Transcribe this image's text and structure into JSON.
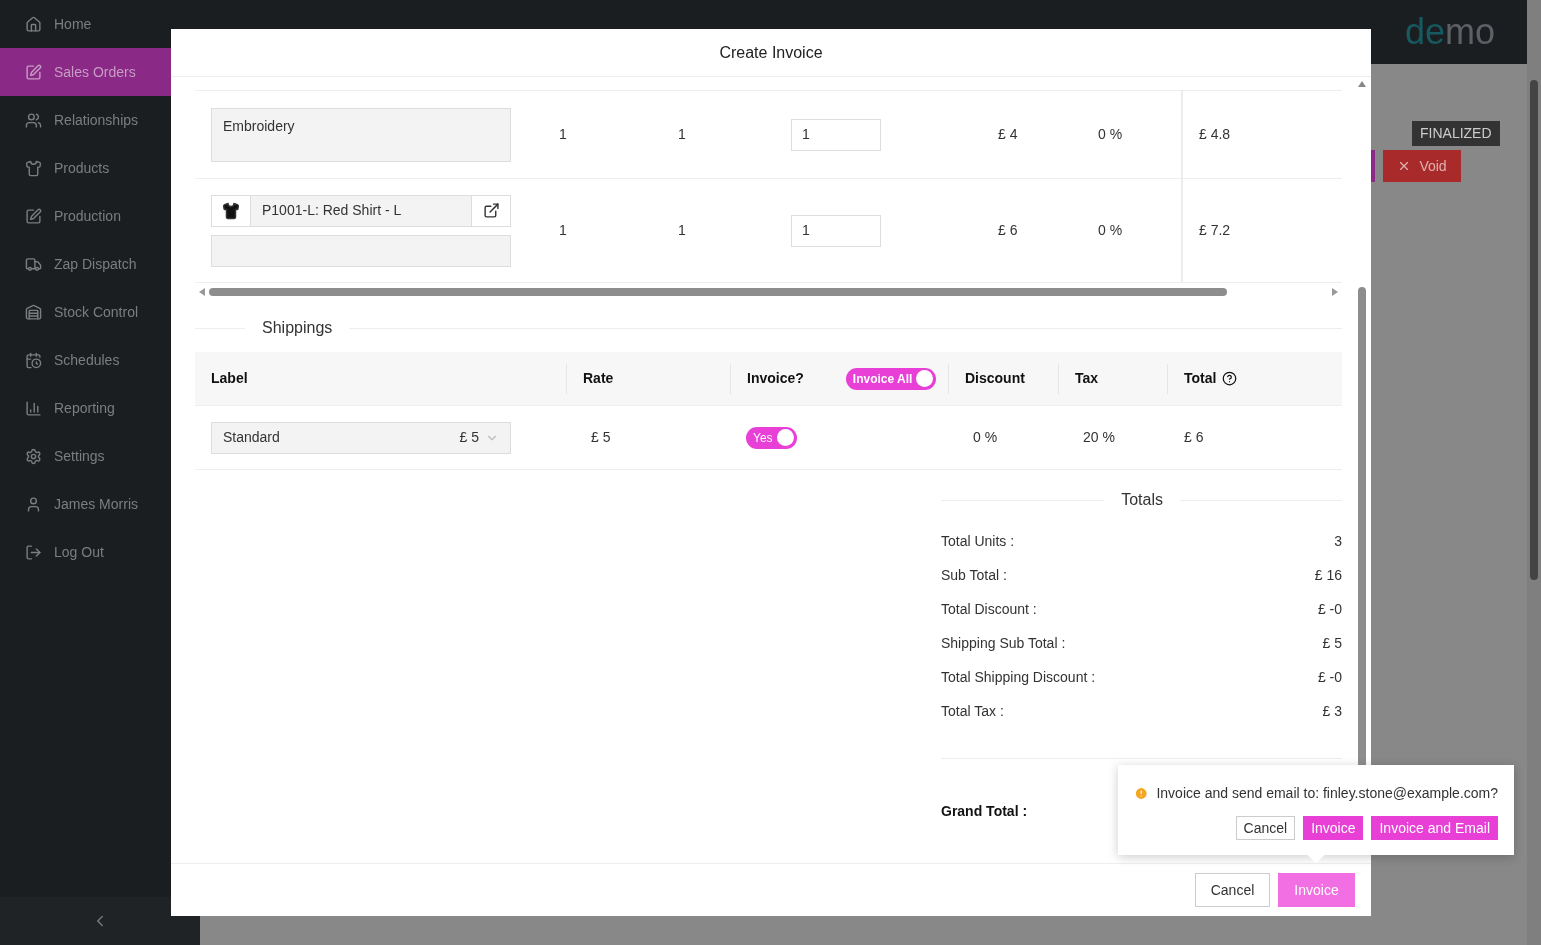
{
  "sidebar": {
    "items": [
      {
        "label": "Home",
        "selected": false
      },
      {
        "label": "Sales Orders",
        "selected": true
      },
      {
        "label": "Relationships",
        "selected": false
      },
      {
        "label": "Products",
        "selected": false
      },
      {
        "label": "Production",
        "selected": false
      },
      {
        "label": "Zap Dispatch",
        "selected": false
      },
      {
        "label": "Stock Control",
        "selected": false
      },
      {
        "label": "Schedules",
        "selected": false
      },
      {
        "label": "Reporting",
        "selected": false
      },
      {
        "label": "Settings",
        "selected": false
      },
      {
        "label": "James Morris",
        "selected": false
      },
      {
        "label": "Log Out",
        "selected": false
      }
    ]
  },
  "header": {
    "brand": [
      "de",
      "mo"
    ]
  },
  "background": {
    "status_badge": "FINALIZED",
    "void_button": "Void"
  },
  "dialog": {
    "title": "Create Invoice",
    "line_items": [
      {
        "kind": "service",
        "description": "Embroidery",
        "col_2": "1",
        "col_3": "1",
        "quantity": "1",
        "price": "£ 4",
        "discount": "0 %",
        "total": "£ 4.8"
      },
      {
        "kind": "product",
        "product": "P1001-L: Red Shirt - L",
        "col_2": "1",
        "col_3": "1",
        "quantity": "1",
        "price": "£ 6",
        "discount": "0 %",
        "total": "£ 7.2"
      }
    ],
    "shippings": {
      "title": "Shippings",
      "columns": [
        "Label",
        "Rate",
        "Invoice?",
        "Discount",
        "Tax",
        "Total"
      ],
      "invoice_all": {
        "label": "Invoice All",
        "on": true
      },
      "rows": [
        {
          "label": "Standard",
          "label_price": "£ 5",
          "rate": "£ 5",
          "invoice": {
            "label": "Yes",
            "on": true
          },
          "discount": "0 %",
          "tax": "20 %",
          "total": "£ 6"
        }
      ]
    },
    "totals": {
      "title": "Totals",
      "rows": [
        {
          "label": "Total Units :",
          "value": "3"
        },
        {
          "label": "Sub Total :",
          "value": "£ 16"
        },
        {
          "label": "Total Discount :",
          "value": "£ -0"
        },
        {
          "label": "Shipping Sub Total :",
          "value": "£ 5"
        },
        {
          "label": "Total Shipping Discount :",
          "value": "£ -0"
        },
        {
          "label": "Total Tax :",
          "value": "£ 3"
        }
      ],
      "grand_total_label": "Grand Total :"
    },
    "footer": {
      "cancel": "Cancel",
      "invoice": "Invoice"
    }
  },
  "popconfirm": {
    "message": "Invoice and send email to: finley.stone@example.com?",
    "buttons": [
      {
        "label": "Cancel",
        "kind": "default"
      },
      {
        "label": "Invoice",
        "kind": "primary"
      },
      {
        "label": "Invoice and Email",
        "kind": "primary"
      }
    ]
  }
}
